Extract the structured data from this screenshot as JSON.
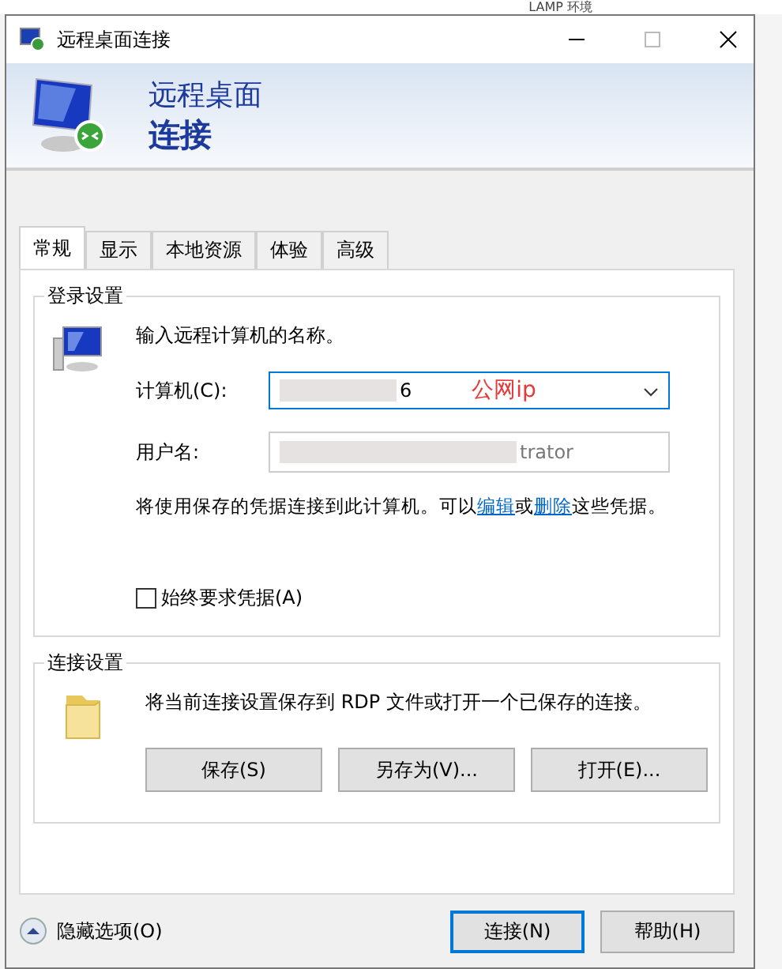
{
  "background": {
    "title": "LAMP 环境"
  },
  "window": {
    "title": "远程桌面连接"
  },
  "banner": {
    "line1": "远程桌面",
    "line2": "连接"
  },
  "tabs": [
    {
      "label": "常规",
      "selected": true
    },
    {
      "label": "显示",
      "selected": false
    },
    {
      "label": "本地资源",
      "selected": false
    },
    {
      "label": "体验",
      "selected": false
    },
    {
      "label": "高级",
      "selected": false
    }
  ],
  "login": {
    "legend": "登录设置",
    "prompt": "输入远程计算机的名称。",
    "computer": {
      "label": "计算机(C):",
      "value": "6",
      "annotation": "公网ip"
    },
    "username": {
      "label": "用户名:",
      "value": "trator"
    },
    "note": {
      "before": "将使用保存的凭据连接到此计算机。可以",
      "link1": "编辑",
      "middle": "或",
      "link2": "删除",
      "after": "这些凭据。"
    },
    "always_ask": {
      "label": "始终要求凭据(A)",
      "checked": false
    }
  },
  "connection": {
    "legend": "连接设置",
    "text": "将当前连接设置保存到 RDP 文件或打开一个已保存的连接。",
    "buttons": [
      "保存(S)",
      "另存为(V)...",
      "打开(E)..."
    ]
  },
  "footer": {
    "toggle": "隐藏选项(O)",
    "buttons": [
      {
        "label": "连接(N)",
        "default": true
      },
      {
        "label": "帮助(H)",
        "default": false
      }
    ]
  }
}
